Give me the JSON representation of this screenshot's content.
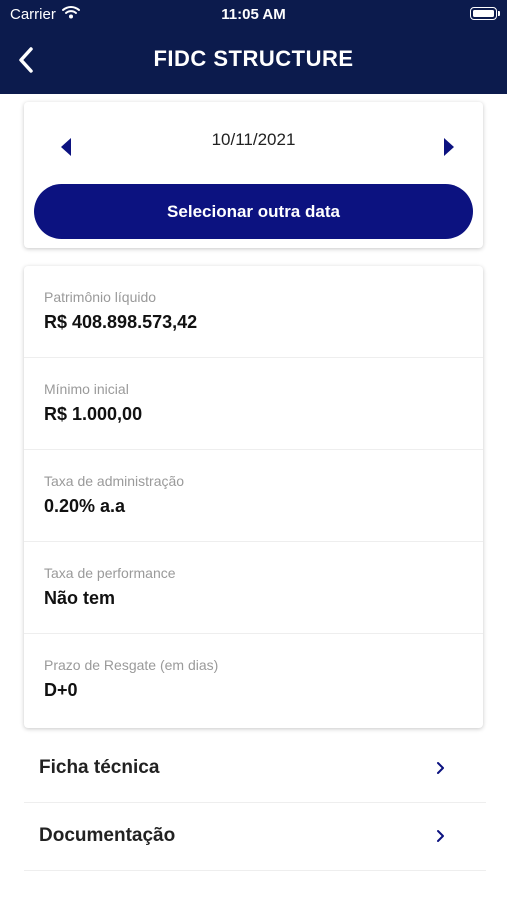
{
  "status_bar": {
    "carrier": "Carrier",
    "time": "11:05 AM",
    "icons": [
      "wifi-icon",
      "battery-icon"
    ]
  },
  "header": {
    "title": "FIDC STRUCTURE",
    "back_icon": "chevron-left-icon"
  },
  "date_selector": {
    "date": "10/11/2021",
    "prev_icon": "triangle-left-icon",
    "next_icon": "triangle-right-icon",
    "button_label": "Selecionar outra data"
  },
  "info": {
    "items": [
      {
        "label": "Patrimônio líquido",
        "value": "R$ 408.898.573,42"
      },
      {
        "label": "Mínimo inicial",
        "value": "R$ 1.000,00"
      },
      {
        "label": "Taxa de administração",
        "value": "0.20% a.a"
      },
      {
        "label": "Taxa de performance",
        "value": "Não tem"
      },
      {
        "label": "Prazo de Resgate (em dias)",
        "value": "D+0"
      }
    ]
  },
  "links": [
    {
      "label": "Ficha técnica",
      "icon": "chevron-right-icon"
    },
    {
      "label": "Documentação",
      "icon": "chevron-right-icon"
    }
  ],
  "colors": {
    "header_bg": "#0c1b4d",
    "button_bg": "#0c1280",
    "arrow": "#0c1280",
    "label_gray": "#9a9a9a"
  }
}
